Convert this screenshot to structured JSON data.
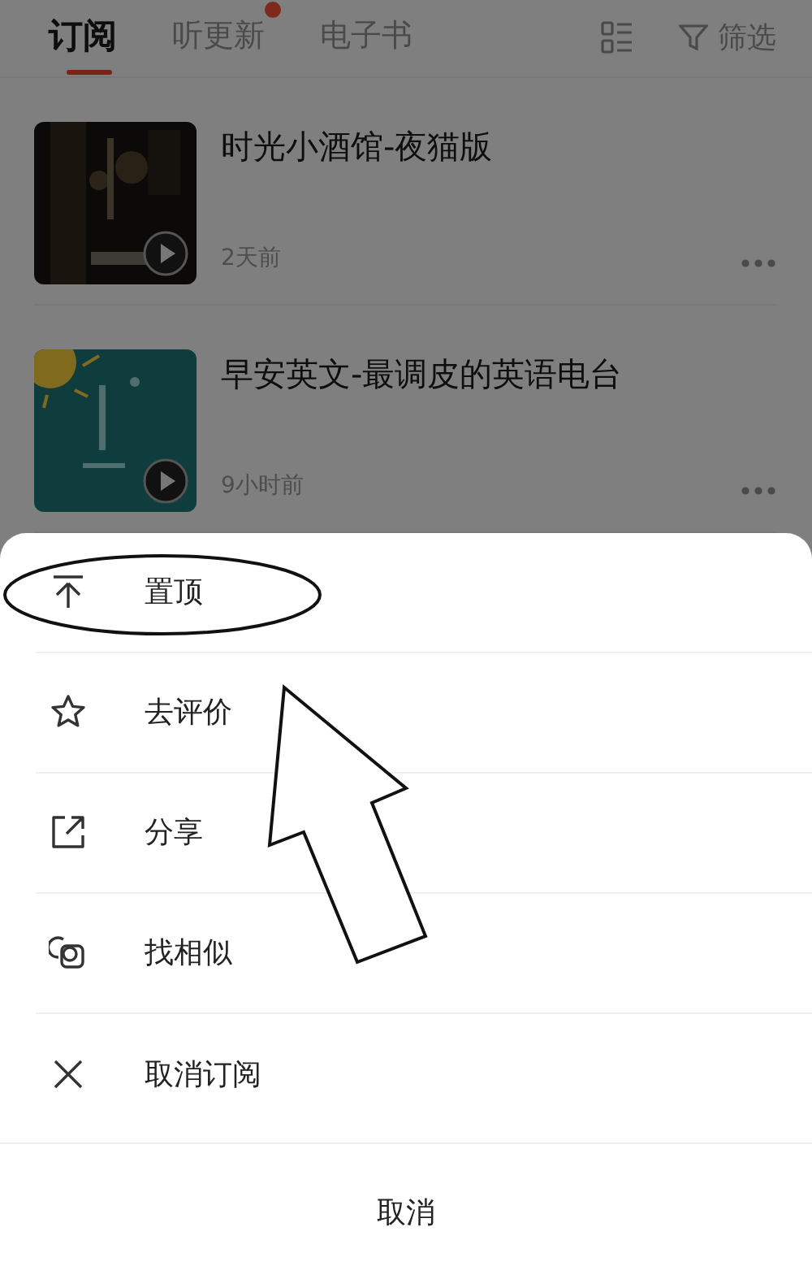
{
  "tabs": [
    {
      "label": "订阅",
      "selected": true,
      "dot": false
    },
    {
      "label": "听更新",
      "selected": false,
      "dot": true
    },
    {
      "label": "电子书",
      "selected": false,
      "dot": false
    }
  ],
  "toolbar": {
    "filter_label": "筛选"
  },
  "subscriptions": [
    {
      "title": "时光小酒馆-夜猫版",
      "time": "2天前"
    },
    {
      "title": "早安英文-最调皮的英语电台",
      "time": "9小时前"
    }
  ],
  "sheet": {
    "items": [
      {
        "kind": "pin",
        "label": "置顶"
      },
      {
        "kind": "star",
        "label": "去评价"
      },
      {
        "kind": "share",
        "label": "分享"
      },
      {
        "kind": "similar",
        "label": "找相似"
      },
      {
        "kind": "close",
        "label": "取消订阅"
      }
    ],
    "cancel": "取消"
  },
  "annotations": {
    "highlight_ellipse": true,
    "pointer_arrow": true
  }
}
